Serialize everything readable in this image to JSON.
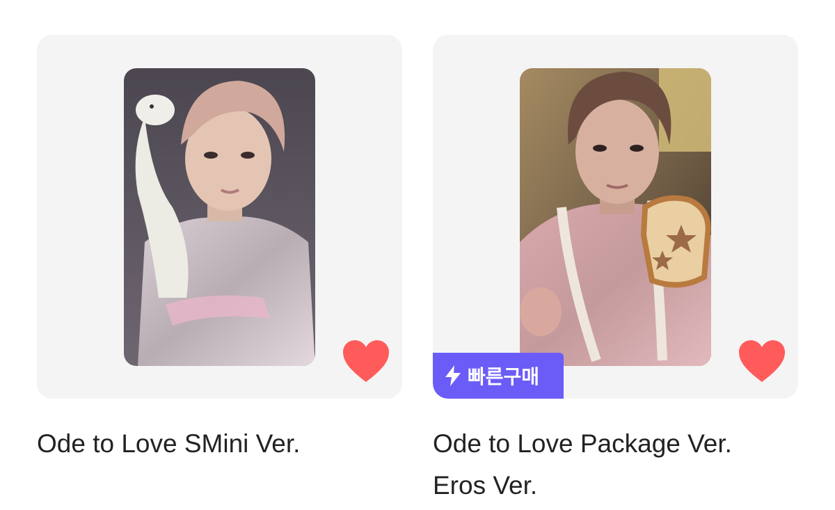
{
  "products": [
    {
      "title": "Ode to Love SMini Ver.",
      "liked": true,
      "badge": null,
      "image_icon": "photocard-image"
    },
    {
      "title_lines": [
        "Ode to Love Package Ver.",
        "Eros Ver."
      ],
      "liked": true,
      "badge": {
        "label": "빠른구매",
        "icon": "lightning-icon",
        "color": "#6b5cf7"
      },
      "image_icon": "photocard-image"
    }
  ],
  "colors": {
    "card_bg": "#f4f4f4",
    "heart": "#ff5b5b",
    "text": "#222222"
  }
}
